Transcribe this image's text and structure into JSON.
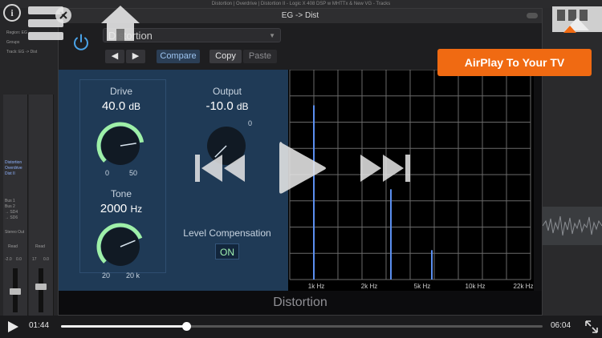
{
  "window": {
    "title": "Distortion | Overdrive | Distortion II - Logic X 408 DSP w MHTTx & New VG - Tracks"
  },
  "host": {
    "region_label": "Region: EG",
    "groups_label": "Groups",
    "track_label": "Track: EG -> Dist",
    "strip_labels": [
      "Distortion",
      "Overdrive",
      "Dist II"
    ],
    "send_labels": [
      "Bus 1",
      "Bus 2",
      "→ SD4",
      "→ SD6"
    ],
    "output_label": "Stereo Out",
    "read_labels": [
      "Read",
      "Read"
    ],
    "level_values": [
      "-2.0",
      "0.0",
      "17",
      "0.0"
    ]
  },
  "plugin": {
    "title": "EG -> Dist",
    "preset": "Distortion",
    "compare_label": "Compare",
    "copy_label": "Copy",
    "paste_label": "Paste",
    "name_label": "Distortion"
  },
  "drive": {
    "label": "Drive",
    "value": "40.0",
    "unit": "dB",
    "min": "0",
    "max": "50",
    "level": 0.8
  },
  "output": {
    "label": "Output",
    "value": "-10.0",
    "unit": "dB",
    "max": "0",
    "level": 0.0
  },
  "tone": {
    "label": "Tone",
    "value": "2000",
    "unit": "Hz",
    "min": "20",
    "max": "20 k",
    "level": 0.75
  },
  "level_compensation": {
    "label": "Level Compensation",
    "state": "ON"
  },
  "analyzer": {
    "x_ticks": [
      "1k Hz",
      "2k Hz",
      "5k Hz",
      "10k Hz",
      "22k Hz"
    ],
    "peaks": [
      {
        "freq_pos": 0.1,
        "level": 0.83
      },
      {
        "freq_pos": 0.42,
        "level": 0.43
      },
      {
        "freq_pos": 0.59,
        "level": 0.14
      }
    ]
  },
  "player": {
    "elapsed": "01:44",
    "remaining": "06:04",
    "progress": 0.25,
    "airplay_label": "AirPlay To Your TV"
  },
  "colors": {
    "accent": "#f06a12",
    "panel": "#1f3a56",
    "knob_arc": "#9ef0a8",
    "power": "#4aa3e8"
  }
}
